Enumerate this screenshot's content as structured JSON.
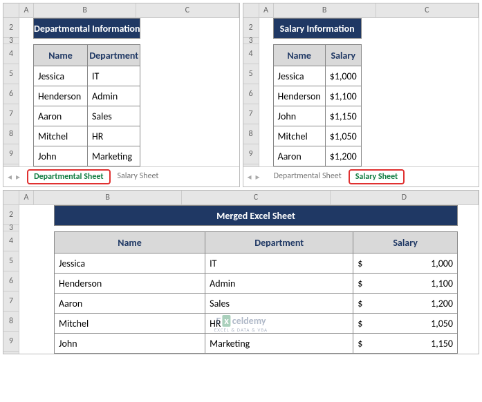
{
  "cols": {
    "a": "A",
    "b": "B",
    "c": "C",
    "d": "D"
  },
  "rows": [
    "2",
    "3",
    "4",
    "5",
    "6",
    "7",
    "8",
    "9"
  ],
  "dept_panel": {
    "title": "Departmental Information",
    "headers": {
      "name": "Name",
      "dept": "Department"
    },
    "rows": [
      {
        "name": "Jessica",
        "dept": "IT"
      },
      {
        "name": "Henderson",
        "dept": "Admin"
      },
      {
        "name": "Aaron",
        "dept": "Sales"
      },
      {
        "name": "Mitchel",
        "dept": "HR"
      },
      {
        "name": "John",
        "dept": "Marketing"
      }
    ],
    "tabs": {
      "active": "Departmental Sheet",
      "other": "Salary Sheet"
    }
  },
  "salary_panel": {
    "title": "Salary Information",
    "headers": {
      "name": "Name",
      "salary": "Salary"
    },
    "currency": "$",
    "rows": [
      {
        "name": "Jessica",
        "salary": "1,000"
      },
      {
        "name": "Henderson",
        "salary": "1,100"
      },
      {
        "name": "John",
        "salary": "1,150"
      },
      {
        "name": "Mitchel",
        "salary": "1,050"
      },
      {
        "name": "Aaron",
        "salary": "1,200"
      }
    ],
    "tabs": {
      "other": "Departmental Sheet",
      "active": "Salary Sheet"
    }
  },
  "merged_panel": {
    "title": "Merged Excel Sheet",
    "headers": {
      "name": "Name",
      "dept": "Department",
      "salary": "Salary"
    },
    "currency": "$",
    "rows": [
      {
        "name": "Jessica",
        "dept": "IT",
        "salary": "1,000"
      },
      {
        "name": "Henderson",
        "dept": "Admin",
        "salary": "1,100"
      },
      {
        "name": "Aaron",
        "dept": "Sales",
        "salary": "1,200"
      },
      {
        "name": "Mitchel",
        "dept": "HR",
        "salary": "1,050"
      },
      {
        "name": "John",
        "dept": "Marketing",
        "salary": "1,150"
      }
    ]
  },
  "watermark": {
    "brand_pre": "E",
    "brand_x": "x",
    "brand_post": "celdemy",
    "sub": "EXCEL & DATA & VBA"
  },
  "icons": {
    "prev": "◂",
    "next": "▸"
  }
}
